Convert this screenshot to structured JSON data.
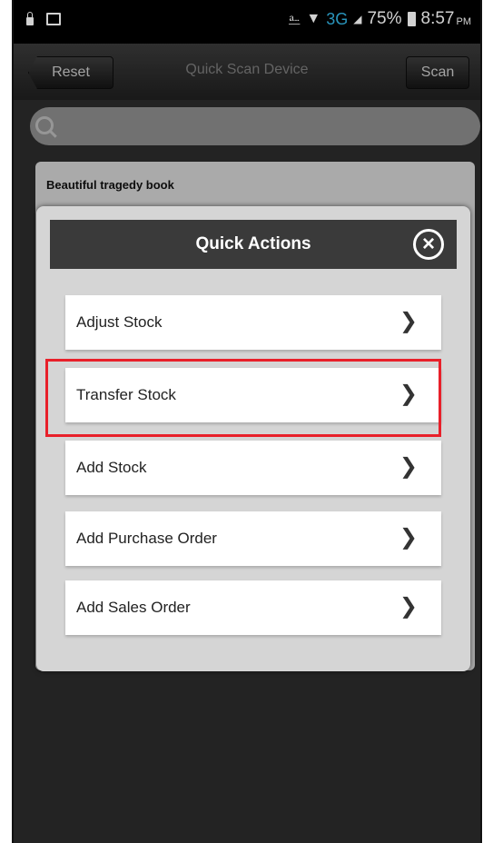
{
  "status_bar": {
    "network": "3G",
    "battery": "75%",
    "time": "8:57",
    "ampm": "PM"
  },
  "action_bar": {
    "reset_label": "Reset",
    "title": "Quick Scan Device",
    "scan_label": "Scan"
  },
  "background_item": {
    "title": "Beautiful tragedy book"
  },
  "dialog": {
    "title": "Quick Actions",
    "items": [
      {
        "label": "Adjust Stock"
      },
      {
        "label": "Transfer Stock"
      },
      {
        "label": "Add Stock"
      },
      {
        "label": "Add Purchase Order"
      },
      {
        "label": "Add Sales Order"
      }
    ],
    "highlighted_item": "Transfer Stock"
  },
  "colors": {
    "highlight": "#e8202a",
    "accent": "#33b5e5"
  }
}
